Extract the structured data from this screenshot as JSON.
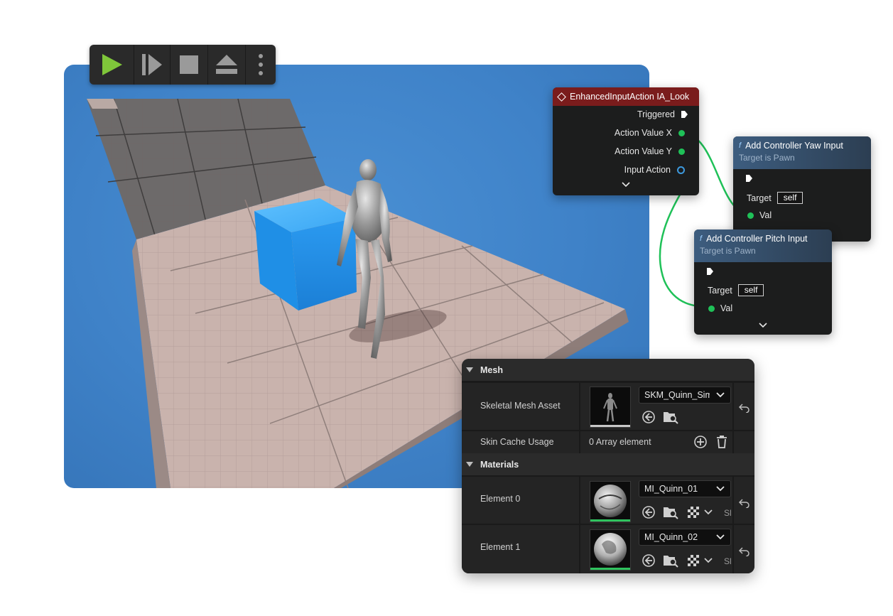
{
  "toolbar": {
    "buttons": [
      {
        "name": "play",
        "icon": "play-icon",
        "color": "#7fc63a"
      },
      {
        "name": "advance-frame",
        "icon": "advance-frame-icon"
      },
      {
        "name": "stop",
        "icon": "stop-icon"
      },
      {
        "name": "eject",
        "icon": "eject-icon"
      },
      {
        "name": "more-options",
        "icon": "more-vertical-icon"
      }
    ]
  },
  "blueprint": {
    "input_node": {
      "title": "EnhancedInputAction IA_Look",
      "header_color": "#7a1c1c",
      "pins": {
        "triggered": "Triggered",
        "action_value_x": "Action Value X",
        "action_value_y": "Action Value Y",
        "input_action": "Input Action"
      }
    },
    "yaw_node": {
      "title": "Add Controller Yaw Input",
      "subtitle": "Target is Pawn",
      "target_label": "Target",
      "target_value": "self",
      "val_label": "Val"
    },
    "pitch_node": {
      "title": "Add Controller Pitch Input",
      "subtitle": "Target is Pawn",
      "target_label": "Target",
      "target_value": "self",
      "val_label": "Val"
    },
    "wire_color": "#1fc158"
  },
  "details": {
    "mesh_section": {
      "title": "Mesh",
      "skeletal_mesh_label": "Skeletal Mesh Asset",
      "skeletal_mesh_value": "SKM_Quinn_Simple",
      "skin_cache_label": "Skin Cache Usage",
      "skin_cache_value": "0 Array element"
    },
    "materials_section": {
      "title": "Materials",
      "elements": [
        {
          "label": "Element 0",
          "value": "MI_Quinn_01",
          "extra": "Sl"
        },
        {
          "label": "Element 1",
          "value": "MI_Quinn_02",
          "extra": "Sl"
        }
      ]
    },
    "accent_color": "#2fc35e"
  }
}
